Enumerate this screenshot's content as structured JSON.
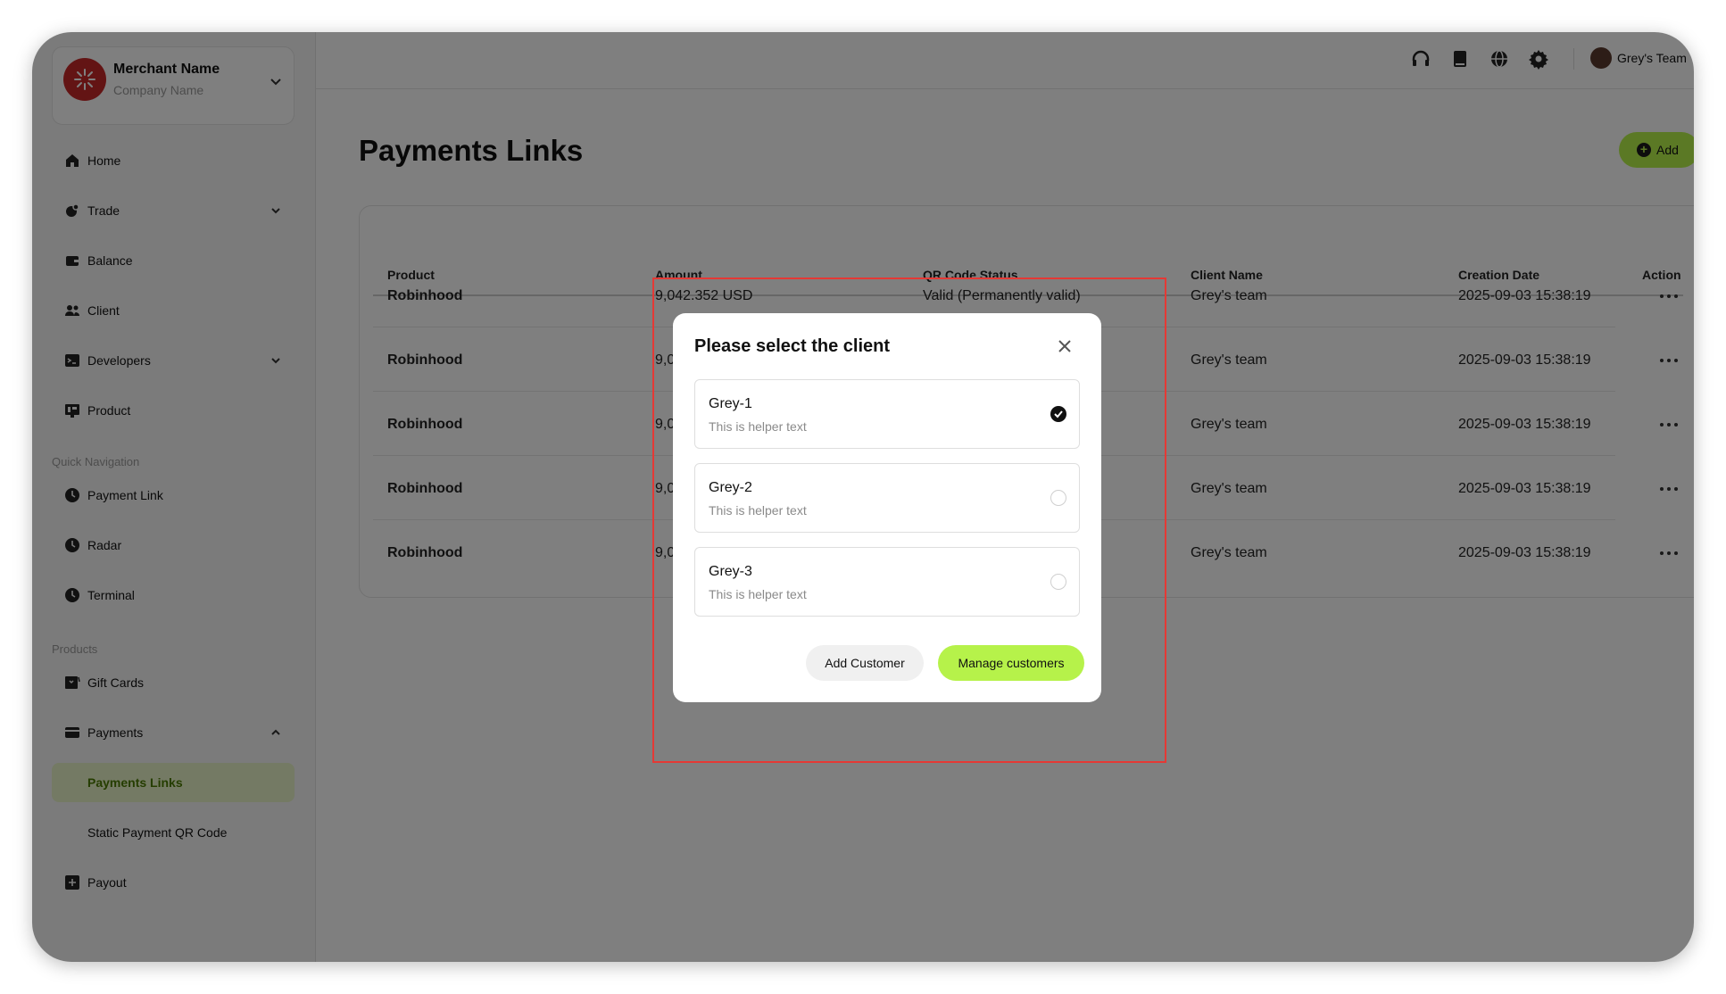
{
  "merchant": {
    "name": "Merchant Name",
    "company": "Company Name"
  },
  "sidebar": {
    "items": [
      {
        "label": "Home",
        "icon": "home-icon"
      },
      {
        "label": "Trade",
        "icon": "trade-icon"
      },
      {
        "label": "Balance",
        "icon": "wallet-icon"
      },
      {
        "label": "Client",
        "icon": "users-icon"
      },
      {
        "label": "Developers",
        "icon": "terminal-icon"
      },
      {
        "label": "Product",
        "icon": "product-icon"
      }
    ],
    "quick_nav_title": "Quick Navigation",
    "quick_nav": [
      {
        "label": "Payment Link",
        "icon": "clock-icon"
      },
      {
        "label": "Radar",
        "icon": "clock-icon"
      },
      {
        "label": "Terminal",
        "icon": "clock-icon"
      }
    ],
    "products_title": "Products",
    "products": [
      {
        "label": "Gift Cards",
        "icon": "gift-card-icon"
      },
      {
        "label": "Payments",
        "icon": "card-icon"
      },
      {
        "label": "Payments Links",
        "active": true
      },
      {
        "label": "Static Payment QR Code"
      },
      {
        "label": "Payout",
        "icon": "payout-icon"
      }
    ]
  },
  "topbar": {
    "icons": [
      "headset-icon",
      "book-icon",
      "globe-icon",
      "gear-icon"
    ],
    "team": "Grey's Team"
  },
  "page": {
    "title": "Payments Links",
    "add_label": "Add"
  },
  "table": {
    "columns": [
      "Product",
      "Amount",
      "QR Code Status",
      "Client Name",
      "Creation Date",
      "Action"
    ],
    "rows": [
      {
        "product": "Robinhood",
        "amount": "9,042.352 USD",
        "status": "Valid (Permanently valid)",
        "client": "Grey's team",
        "date": "2025-09-03 15:38:19"
      },
      {
        "product": "Robinhood",
        "amount": "9,0",
        "status": "",
        "client": "Grey's team",
        "date": "2025-09-03 15:38:19"
      },
      {
        "product": "Robinhood",
        "amount": "9,0",
        "status": "",
        "client": "Grey's team",
        "date": "2025-09-03 15:38:19"
      },
      {
        "product": "Robinhood",
        "amount": "9,0",
        "status": "",
        "client": "Grey's team",
        "date": "2025-09-03 15:38:19"
      },
      {
        "product": "Robinhood",
        "amount": "9,0",
        "status": "",
        "client": "Grey's team",
        "date": "2025-09-03 15:38:19"
      }
    ]
  },
  "modal": {
    "title": "Please select the client",
    "options": [
      {
        "name": "Grey-1",
        "helper": "This is helper text",
        "selected": true
      },
      {
        "name": "Grey-2",
        "helper": "This is helper text",
        "selected": false
      },
      {
        "name": "Grey-3",
        "helper": "This is helper text",
        "selected": false
      }
    ],
    "add_customer": "Add Customer",
    "manage_customers": "Manage customers"
  },
  "colors": {
    "accent": "#b6f24a",
    "highlight": "#e53935",
    "brand": "#c62828"
  }
}
